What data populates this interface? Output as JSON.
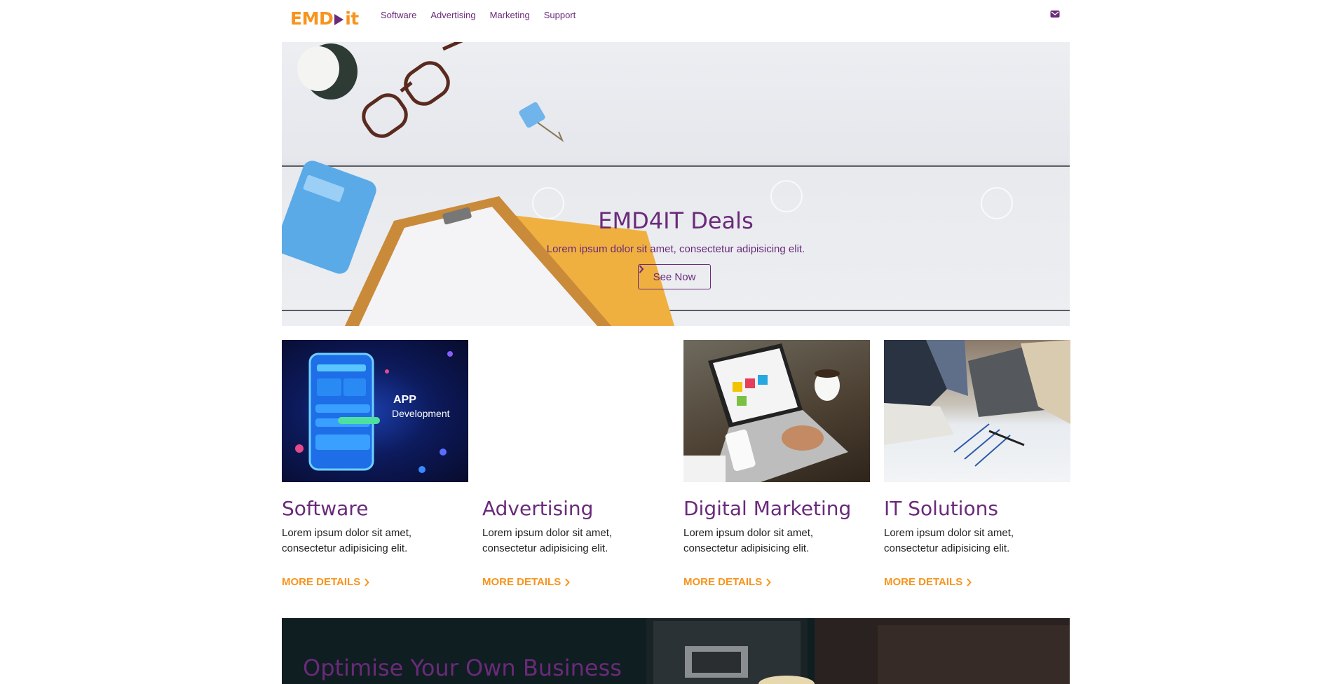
{
  "brand": {
    "logo_left": "EMD",
    "logo_right": "it"
  },
  "nav": {
    "items": [
      "Software",
      "Advertising",
      "Marketing",
      "Support"
    ]
  },
  "hero": {
    "title": "EMD4IT Deals",
    "subtitle": "Lorem ipsum dolor sit amet, consectetur adipisicing elit.",
    "button_label": "See Now"
  },
  "image_text": {
    "app_title": "APP",
    "app_subtitle": "Development"
  },
  "cards": [
    {
      "title": "Software",
      "text": "Lorem ipsum dolor sit amet, consectetur adipisicing elit.",
      "link": "MORE DETAILS"
    },
    {
      "title": "Advertising",
      "text": "Lorem ipsum dolor sit amet, consectetur adipisicing elit.",
      "link": "MORE DETAILS"
    },
    {
      "title": "Digital Marketing",
      "text": "Lorem ipsum dolor sit amet, consectetur adipisicing elit.",
      "link": "MORE DETAILS"
    },
    {
      "title": "IT Solutions",
      "text": "Lorem ipsum dolor sit amet, consectetur adipisicing elit.",
      "link": "MORE DETAILS"
    }
  ],
  "banner": {
    "title": "Optimise Your Own Business"
  },
  "colors": {
    "brand_orange": "#f7941d",
    "brand_purple": "#6a2a7a"
  },
  "icons": {
    "header": "mail-icon",
    "button": "chevron-right-icon"
  }
}
